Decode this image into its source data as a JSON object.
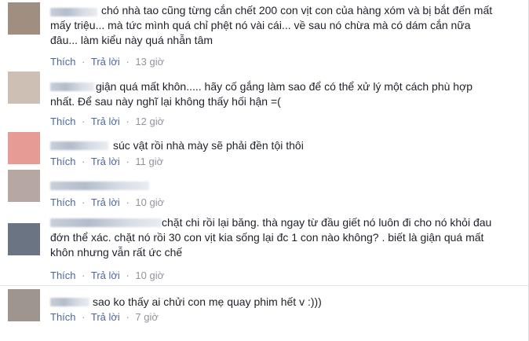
{
  "labels": {
    "like": "Thích",
    "reply": "Trả lời",
    "dot": "·"
  },
  "comments": [
    {
      "text": "chó nhà tao cũng từng cắn chết 200 con vịt con của hàng xóm và bị bắt đến mất\nmấy triệu... mà tức mình quá chỉ phệt nó vài cái... về sau nó chừa mà có dám cắn nữa\nđâu... làm kiểu này quá nhẫn tâm",
      "time": "13 giờ",
      "avatar_color": "#a08e80"
    },
    {
      "text": "giận quá mất khôn..... hãy cố gắng làm sao để có thể xử lý một cách phù hợp\nnhất. Để sau này nghĩ lại không thấy hối hận =(",
      "time": "12 giờ",
      "avatar_color": "#cdbfb4"
    },
    {
      "text": "súc vật rồi nhà mày sẽ phải đền tội thôi",
      "time": "11 giờ",
      "avatar_color": "#e79b95"
    },
    {
      "text": "",
      "time": "10 giờ",
      "avatar_color": "#b7a7a2"
    },
    {
      "text": "chặt chi rồi lại băng. thà ngay từ đầu giết nó luôn đi cho nó khỏi đau\nđớn thể xác. chặt nó rồi 30 con vịt kia sống lại đc 1 con nào không? . biết là giận quá mất\nkhôn nhưng vẫn rất ức chế",
      "time": "10 giờ",
      "avatar_color": "#6b7482"
    },
    {
      "text": "sao ko thấy ai chửi con mẹ quay phim hết v :)))",
      "time": "7 giờ",
      "avatar_color": "#9e958e"
    }
  ]
}
